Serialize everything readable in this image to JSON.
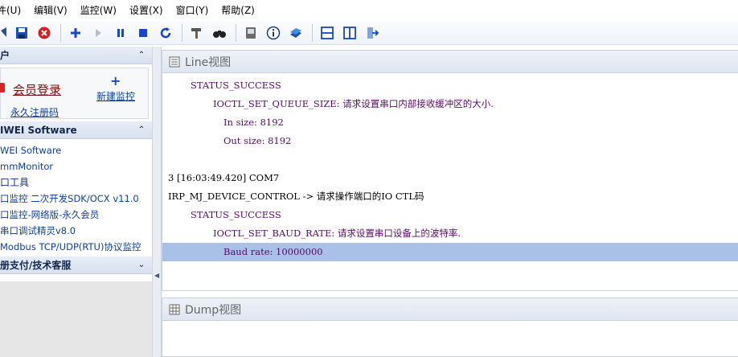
{
  "menu": [
    "件(U)",
    "编辑(V)",
    "监控(W)",
    "设置(X)",
    "窗口(Y)",
    "帮助(Z)"
  ],
  "toolbar_icons": [
    "dropdown-icon",
    "save-icon",
    "stop-red-icon",
    "add-icon",
    "play-icon",
    "pause-icon",
    "stop-icon",
    "refresh-icon",
    "tools-icon",
    "binoculars-icon",
    "device-icon",
    "info-icon",
    "book-icon",
    "split-horizontal-icon",
    "split-vertical-icon",
    "exit-icon"
  ],
  "left": {
    "user_section_title": "户",
    "login_label": "会员登录",
    "register_label": "永久注册码",
    "new_monitor_label": "新建监控",
    "software_section_title": "IWEI Software",
    "links": [
      "WEI Software",
      "mmMonitor",
      "口工具",
      "口监控 二次开发SDK/OCX v11.0",
      "口监控-网络版-永久会员",
      "串口调试精灵v8.0",
      "Modbus TCP/UDP(RTU)协议监控"
    ],
    "payment_section_title": "册支付/技术客服"
  },
  "line_view": {
    "title": "Line视图",
    "rows": [
      "STATUS_SUCCESS",
      "IOCTL_SET_QUEUE_SIZE: 请求设置串口内部接收缓冲区的大小.",
      "In size: 8192",
      "Out size: 8192",
      "",
      "3 [16:03:49.420] COM7",
      "IRP_MJ_DEVICE_CONTROL -> 请求操作端口的IO CTL码",
      "STATUS_SUCCESS",
      "IOCTL_SET_BAUD_RATE: 请求设置串口设备上的波特率.",
      "Baud rate: 10000000"
    ]
  },
  "dump_view": {
    "title": "Dump视图"
  },
  "colors": {
    "accent": "#1746c9",
    "highlight": "#a9c1e6",
    "text_purple": "#5b0a6b"
  }
}
